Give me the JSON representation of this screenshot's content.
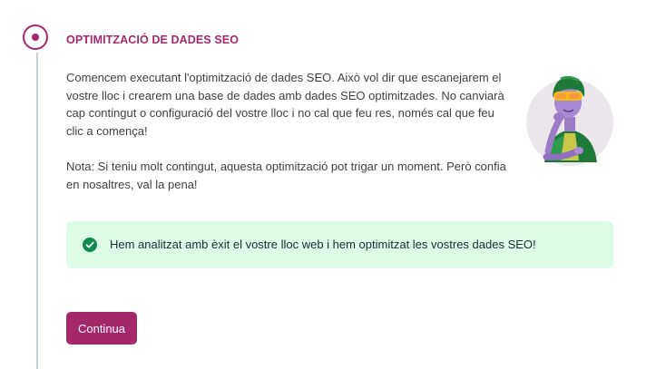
{
  "step": {
    "title": "OPTIMITZACIÓ DE DADES SEO",
    "description": "Comencem executant l'optimització de dades SEO. Això vol dir que escanejarem el vostre lloc i crearem una base de dades amb dades SEO optimitzades. No canviarà cap contingut o configuració del vostre lloc i no cal que feu res, només cal que feu clic a comença!",
    "note": "Nota: Si teniu molt contingut, aquesta optimització pot trigar un moment. Però confia en nosaltres, val la pena!"
  },
  "alert": {
    "icon": "check-circle-icon",
    "message": "Hem analitzat amb èxit el vostre lloc web i hem optimitzat les vostres dades SEO!"
  },
  "buttons": {
    "continue_label": "Continua"
  },
  "colors": {
    "accent": "#a4286a",
    "success_bg": "#dcfce6",
    "success_icon": "#0f8a4a",
    "timeline": "#c3cfdb"
  }
}
